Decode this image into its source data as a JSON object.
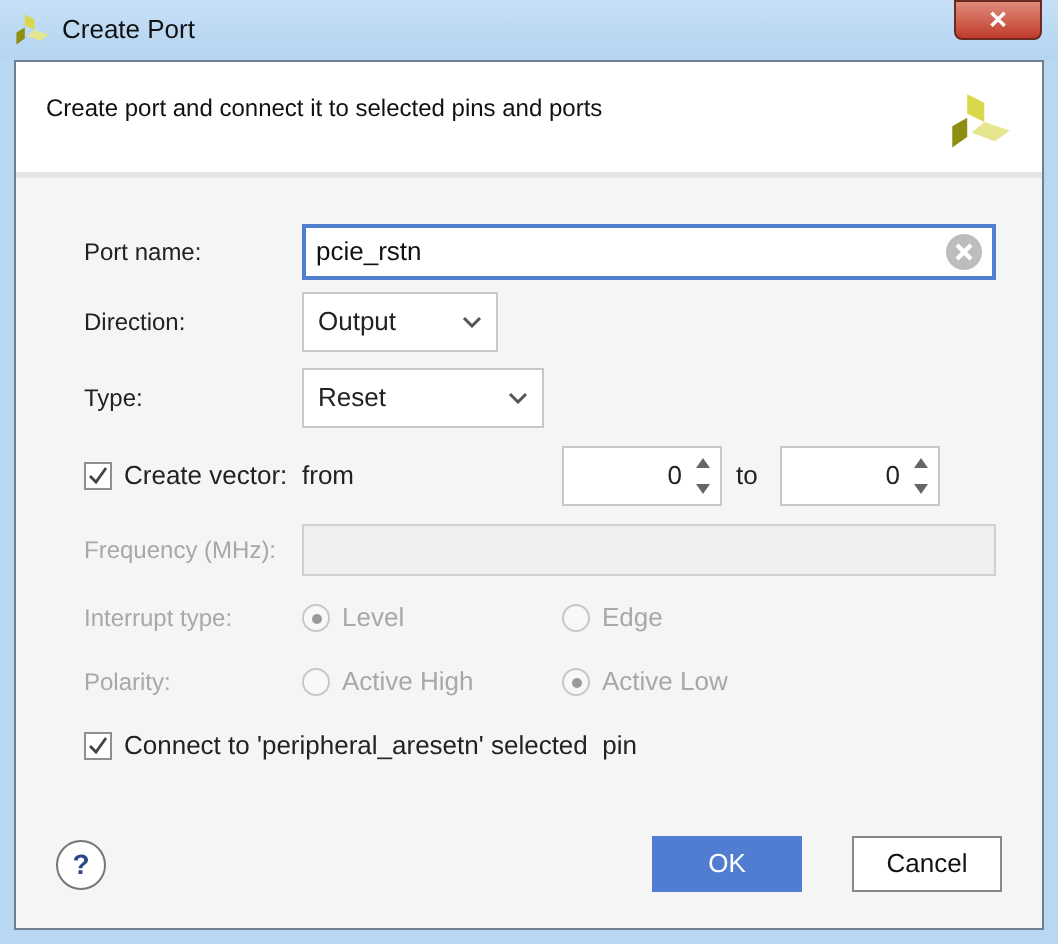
{
  "window": {
    "title": "Create Port",
    "close": "✕"
  },
  "header": {
    "description": "Create port and connect it to selected pins and ports"
  },
  "port_name": {
    "label": "Port name:",
    "value": "pcie_rstn"
  },
  "direction": {
    "label": "Direction:",
    "value": "Output"
  },
  "type": {
    "label": "Type:",
    "value": "Reset"
  },
  "vector": {
    "label": "Create vector:",
    "checked": true,
    "from_label": "from",
    "from": "0",
    "to_label": "to",
    "to": "0"
  },
  "frequency": {
    "label": "Frequency (MHz):",
    "disabled": true
  },
  "radio_groups": [
    {
      "label": "Interrupt type:",
      "disabled": true,
      "options": [
        {
          "label": "Level",
          "selected": true
        },
        {
          "label": "Edge",
          "selected": false
        }
      ]
    },
    {
      "label": "Polarity:",
      "disabled": true,
      "options": [
        {
          "label": "Active High",
          "selected": false
        },
        {
          "label": "Active Low",
          "selected": true
        }
      ]
    }
  ],
  "connect": {
    "label": "Connect to 'peripheral_aresetn' selected  pin",
    "checked": true
  },
  "help": "?",
  "buttons": [
    {
      "label": "OK",
      "kind": "primary"
    },
    {
      "label": "Cancel",
      "kind": "secondary"
    }
  ]
}
